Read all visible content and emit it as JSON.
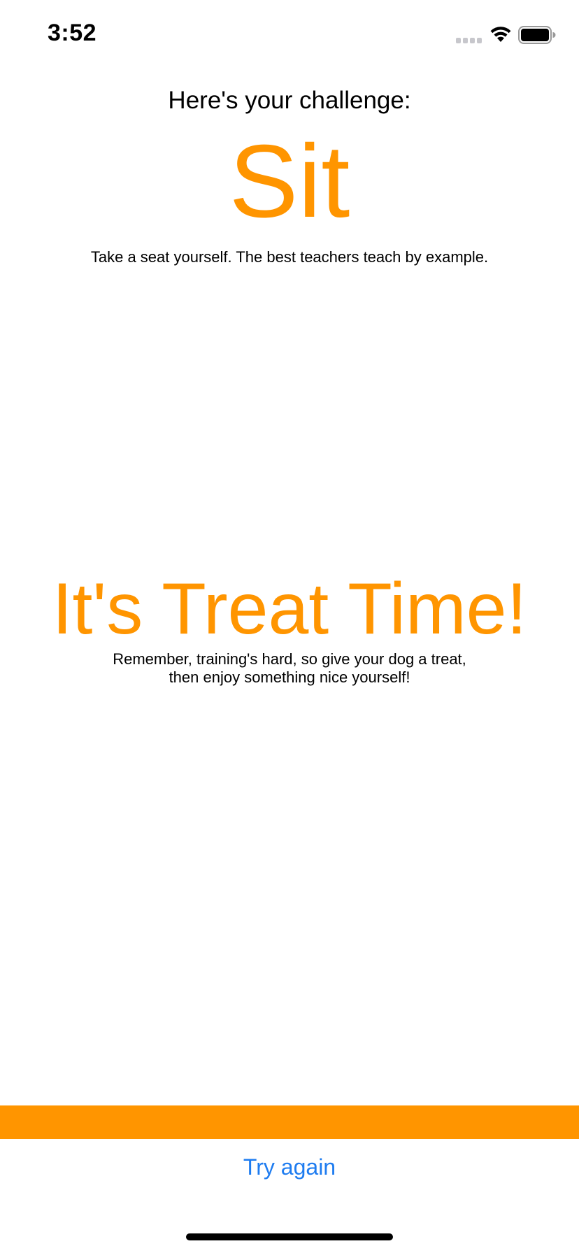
{
  "status_bar": {
    "time": "3:52"
  },
  "challenge": {
    "heading": "Here's your challenge:",
    "command": "Sit",
    "description": "Take a seat yourself. The best teachers teach by example."
  },
  "treat": {
    "title": "It's Treat Time!",
    "message_line1": "Remember, training's hard, so give your dog a treat,",
    "message_line2": "then enjoy something nice yourself!"
  },
  "actions": {
    "try_again_label": "Try again"
  },
  "colors": {
    "accent": "#FF9500",
    "link": "#1E7CF0"
  },
  "icons": [
    "signal-icon",
    "wifi-icon",
    "battery-icon"
  ]
}
